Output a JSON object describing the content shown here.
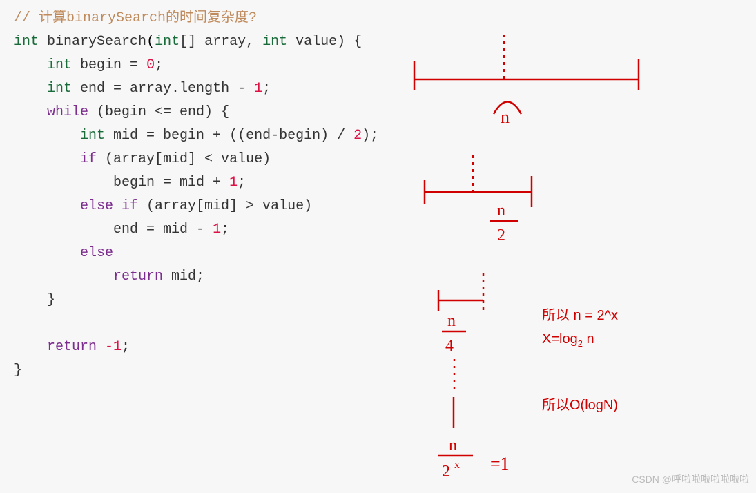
{
  "code": {
    "comment": "// 计算binarySearch的时间复杂度?",
    "sig_int": "int",
    "sig_name": "binarySearch",
    "sig_p1_type": "int",
    "sig_p1_name": "[] array, ",
    "sig_p2_type": "int",
    "sig_p2_name": " value) {",
    "l3_int": "int",
    "l3_rest": " begin = ",
    "l3_zero": "0",
    "l3_semi": ";",
    "l4_int": "int",
    "l4_rest": " end = array.length - ",
    "l4_one": "1",
    "l4_semi": ";",
    "l5_while": "while",
    "l5_rest": " (begin <= end) {",
    "l6_int": "int",
    "l6_rest": " mid = begin + ((end-begin) / ",
    "l6_two": "2",
    "l6_end": ");",
    "l7_if": "if",
    "l7_rest": " (array[mid] < value)",
    "l8": "begin = mid + ",
    "l8_one": "1",
    "l8_semi": ";",
    "l9_elseif": "else if",
    "l9_rest": " (array[mid] > value)",
    "l10": "end = mid - ",
    "l10_one": "1",
    "l10_semi": ";",
    "l11_else": "else",
    "l12_return": "return",
    "l12_rest": " mid;",
    "l13": "}",
    "l14_return": "return",
    "l14_minus1": " -1",
    "l14_semi": ";",
    "l15": "}"
  },
  "annotations": {
    "n_label": "n",
    "n_over_2": "n",
    "over_2_denom": "2",
    "n_over_4_num": "n",
    "n_over_4_denom": "4",
    "n_over_2x_num": "n",
    "n_over_2x_denom": "2",
    "n_over_2x_exp": "x",
    "equals_1": "=1",
    "derivation1": "所以  n = 2^x",
    "derivation2_prefix": "X=log",
    "derivation2_sub": "2",
    "derivation2_suffix": " n",
    "conclusion": "所以O(logN)"
  },
  "watermark": "CSDN @呼啦啦啦啦啦啦啦"
}
